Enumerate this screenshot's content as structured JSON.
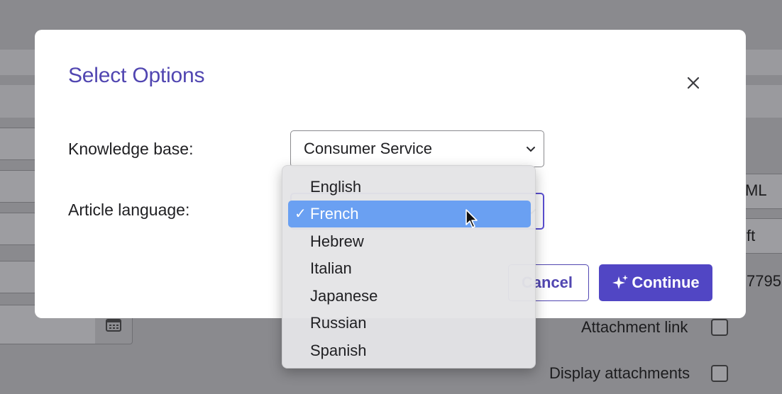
{
  "background": {
    "right_texts": [
      "ML",
      "ft",
      "7795"
    ],
    "attachment_link_label": "Attachment link",
    "display_attachments_label": "Display attachments",
    "calendar_icon": "calendar-icon"
  },
  "modal": {
    "title": "Select Options",
    "close_icon": "close-icon",
    "knowledge_base_label": "Knowledge base:",
    "knowledge_base_value": "Consumer Service",
    "article_language_label": "Article language:",
    "article_language_value": "French",
    "cancel_label": "Cancel",
    "continue_label": "Continue",
    "continue_icon": "sparkle-icon",
    "accent_color": "#5146b1"
  },
  "dropdown": {
    "options": [
      "English",
      "French",
      "Hebrew",
      "Italian",
      "Japanese",
      "Russian",
      "Spanish"
    ],
    "selected": "French",
    "check_mark": "✓",
    "highlight_color": "#6aa0f2"
  }
}
